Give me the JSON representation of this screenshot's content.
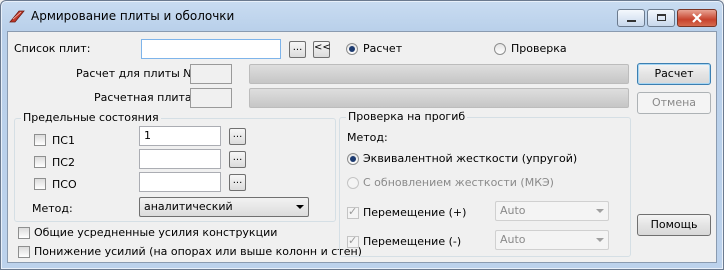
{
  "window": {
    "title": "Армирование плиты и оболочки",
    "icon": "reinforcement-app-icon",
    "controls": [
      "minimize-icon",
      "maximize-icon",
      "close-icon"
    ]
  },
  "top": {
    "plate_list_label": "Список плит:",
    "plate_list_value": "",
    "browse_btn": "...",
    "back_btn": "<<",
    "mode_calc": "Расчет",
    "mode_check": "Проверка",
    "calc_for_plate_label": "Расчет для плиты №:",
    "calc_plate_label": "Расчетная плита:"
  },
  "buttons": {
    "calc": "Расчет",
    "cancel": "Отмена",
    "help": "Помощь"
  },
  "limit_states": {
    "title": "Предельные состояния",
    "items": [
      {
        "label": "ПС1",
        "value": "1",
        "btn": "..."
      },
      {
        "label": "ПС2",
        "value": "",
        "btn": "..."
      },
      {
        "label": "ПСО",
        "value": "",
        "btn": "..."
      }
    ],
    "method_label": "Метод:",
    "method_value": "аналитический"
  },
  "options": {
    "avg_forces": "Общие усредненные усилия конструкции",
    "reduce_forces": "Понижение усилий (на опорах или выше колонн и стен)"
  },
  "deflection": {
    "title": "Проверка на прогиб",
    "method_label": "Метод:",
    "method_equiv": "Эквивалентной жесткости (упругой)",
    "method_update": "С обновлением жесткости (МКЭ)",
    "move_plus": "Перемещение (+)",
    "move_plus_value": "Auto",
    "move_minus": "Перемещение (-)",
    "move_minus_value": "Auto"
  },
  "colors": {
    "title_bar": "#c4d8ef",
    "client_bg": "#f0f0f0",
    "radio_dot": "#1c3a70"
  }
}
